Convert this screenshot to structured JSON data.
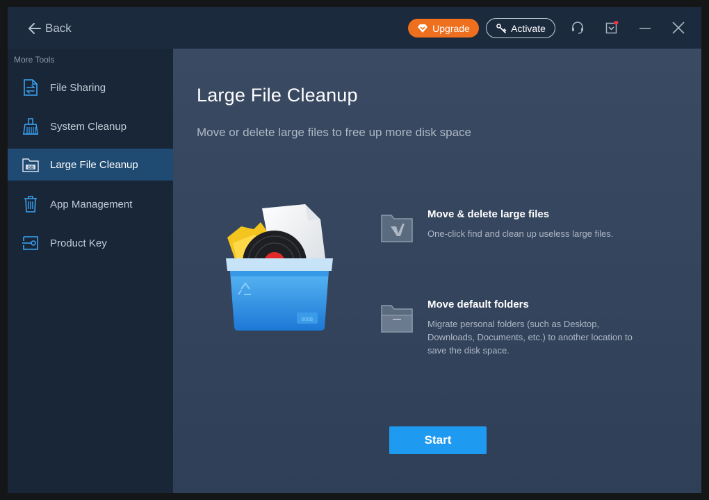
{
  "header": {
    "back_label": "Back",
    "upgrade_label": "Upgrade",
    "activate_label": "Activate"
  },
  "sidebar": {
    "heading": "More Tools",
    "items": [
      {
        "label": "File Sharing",
        "icon": "file-sharing-icon"
      },
      {
        "label": "System Cleanup",
        "icon": "broom-icon"
      },
      {
        "label": "Large File Cleanup",
        "icon": "gb-folder-icon",
        "active": true
      },
      {
        "label": "App Management",
        "icon": "trash-icon"
      },
      {
        "label": "Product Key",
        "icon": "key-icon"
      }
    ]
  },
  "main": {
    "title": "Large File Cleanup",
    "subtitle": "Move or delete large files to free up more disk space",
    "features": [
      {
        "title": "Move & delete large files",
        "description": "One-click find and clean up useless large files."
      },
      {
        "title": "Move default folders",
        "description": "Migrate personal folders (such as Desktop, Downloads, Documents, etc.) to another location to save the disk space."
      }
    ],
    "start_label": "Start"
  },
  "colors": {
    "accent": "#1e9bf0",
    "upgrade": "#ee6f1d",
    "active_nav": "#1f4a72",
    "notification_dot": "#e8343a"
  }
}
